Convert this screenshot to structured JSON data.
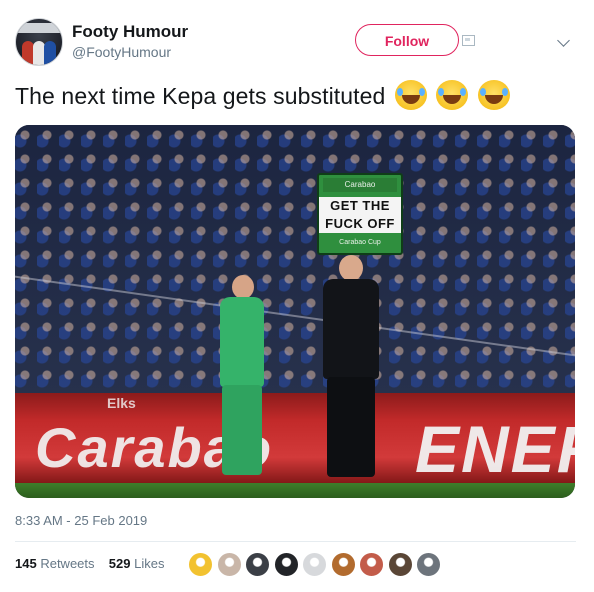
{
  "tweet": {
    "author_name": "Footy Humour",
    "author_handle": "@FootyHumour",
    "follow_label": "Follow",
    "text": "The next time Kepa gets substituted",
    "emoji": [
      "face-with-tears-of-joy",
      "face-with-tears-of-joy",
      "face-with-tears-of-joy"
    ],
    "timestamp": "8:33 AM - 25 Feb 2019",
    "retweets_count": "145",
    "retweets_label": "Retweets",
    "likes_count": "529",
    "likes_label": "Likes"
  },
  "photo": {
    "sign_top": "Carabao",
    "sign_line1": "GET THE",
    "sign_line2": "FUCK OFF",
    "sign_bottom": "Carabao Cup",
    "board_left": "Carabao",
    "board_right": "ENER",
    "board_small": "Elks"
  },
  "likers": [
    {
      "color": "#f2c230"
    },
    {
      "color": "#c9b6a8"
    },
    {
      "color": "#3b3f46"
    },
    {
      "color": "#222428"
    },
    {
      "color": "#d7d9dc"
    },
    {
      "color": "#b26b2e"
    },
    {
      "color": "#c35c4a"
    },
    {
      "color": "#5a4636"
    },
    {
      "color": "#6d747c"
    }
  ],
  "colors": {
    "accent": "#e0245e",
    "muted": "#657786",
    "text": "#14171a"
  }
}
